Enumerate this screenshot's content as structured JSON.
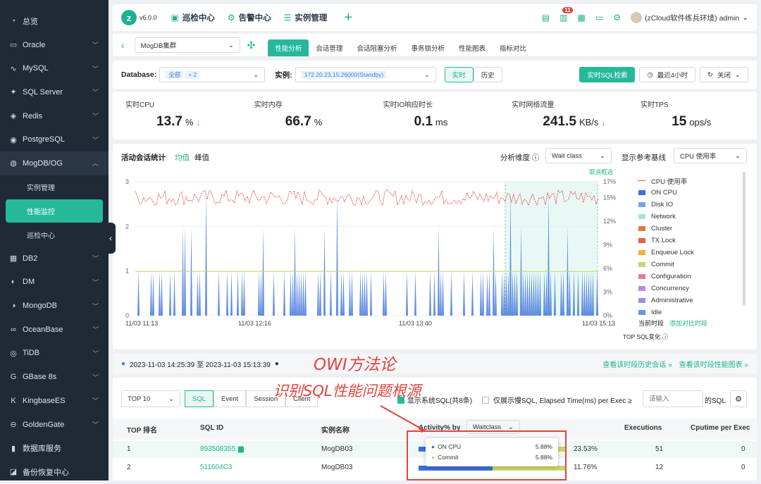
{
  "sidebar": {
    "items": [
      {
        "icon": "gauge-icon",
        "label": "总览"
      },
      {
        "icon": "oracle-icon",
        "label": "Oracle"
      },
      {
        "icon": "mysql-icon",
        "label": "MySQL"
      },
      {
        "icon": "sqlserver-icon",
        "label": "SQL Server"
      },
      {
        "icon": "redis-icon",
        "label": "Redis"
      },
      {
        "icon": "postgresql-icon",
        "label": "PostgreSQL"
      },
      {
        "icon": "mogdb-icon",
        "label": "MogDB/OG"
      },
      {
        "icon": "db2-icon",
        "label": "DB2"
      },
      {
        "icon": "dm-icon",
        "label": "DM"
      },
      {
        "icon": "mongodb-icon",
        "label": "MongoDB"
      },
      {
        "icon": "oceanbase-icon",
        "label": "OceanBase"
      },
      {
        "icon": "tidb-icon",
        "label": "TiDB"
      },
      {
        "icon": "gbase-icon",
        "label": "GBase 8s"
      },
      {
        "icon": "kingbase-icon",
        "label": "KingbaseES"
      },
      {
        "icon": "goldengate-icon",
        "label": "GoldenGate"
      },
      {
        "icon": "database-service-icon",
        "label": "数据库服务"
      },
      {
        "icon": "backup-icon",
        "label": "备份恢复中心"
      }
    ],
    "sub": [
      "实例管理",
      "性能监控",
      "巡检中心"
    ]
  },
  "top": {
    "version": "v6.0.0",
    "nav": [
      "巡检中心",
      "告警中心",
      "实例管理"
    ],
    "badge": "11",
    "user": "(zCloud软件练兵环境) admin"
  },
  "tabs": {
    "cluster": "MogDB集群",
    "items": [
      "性能分析",
      "会话管理",
      "会话阻塞分析",
      "事务锁分析",
      "性能图表",
      "指标对比"
    ]
  },
  "filter": {
    "db_label": "Database:",
    "db_tag": "全部",
    "db_more": "+ 2",
    "inst_label": "实例:",
    "inst_value": "172.20.23.15:26000(Standby)",
    "realtime": "实时",
    "history": "历史",
    "sql_search": "实时SQL检索",
    "time": "最近4小时",
    "refresh": "关闭"
  },
  "metrics": [
    {
      "label": "实时CPU",
      "value": "13.7",
      "unit": "%",
      "arrow": "↓"
    },
    {
      "label": "实时内存",
      "value": "66.7",
      "unit": "%",
      "arrow": ""
    },
    {
      "label": "实时IO响应时长",
      "value": "0.1",
      "unit": "ms",
      "arrow": ""
    },
    {
      "label": "实时网络流量",
      "value": "241.5",
      "unit": "KB/s",
      "arrow": "↓"
    },
    {
      "label": "实时TPS",
      "value": "15",
      "unit": "ops/s",
      "arrow": ""
    }
  ],
  "chart_header": {
    "title": "活动会话统计",
    "avg": "均值",
    "peak": "峰值",
    "dim_label": "分析维度",
    "dim_value": "Wait class",
    "base_label": "显示参考基线",
    "base_value": "CPU 使用率",
    "cancel": "取消框选",
    "current": "当前时段",
    "add_compare": "添加对比时段",
    "top_sql": "TOP SQL变化"
  },
  "chart_data": {
    "type": "area",
    "yticks_left": [
      "0",
      "1",
      "2",
      "3"
    ],
    "yticks_right": [
      "0%",
      "3%",
      "6%",
      "9%",
      "12%",
      "15%",
      "17%"
    ],
    "xticks": [
      "11/03 11:13",
      "11/03 12:16",
      "11/03 13:40",
      "11/03 15:13"
    ],
    "ylim_left": [
      0,
      3
    ],
    "ylim_right": [
      0,
      17
    ],
    "series": [
      {
        "name": "CPU 使用率",
        "color": "#e7423c"
      },
      {
        "name": "ON CPU",
        "color": "#3a6fdc"
      },
      {
        "name": "Disk IO",
        "color": "#6fa8e8"
      },
      {
        "name": "Network",
        "color": "#a8e3d6"
      },
      {
        "name": "Cluster",
        "color": "#e8744a"
      },
      {
        "name": "TX Lock",
        "color": "#e5603e"
      },
      {
        "name": "Enqueue Lock",
        "color": "#f0b13a"
      },
      {
        "name": "Commit",
        "color": "#c9d66a"
      },
      {
        "name": "Configuration",
        "color": "#e77a9f"
      },
      {
        "name": "Concurrency",
        "color": "#b98ae6"
      },
      {
        "name": "Administrative",
        "color": "#9c8fe0"
      },
      {
        "name": "Idle",
        "color": "#6c8ff0"
      }
    ],
    "cpu_line_percent": 15,
    "grid": true,
    "legend": "right"
  },
  "info": {
    "range": "2023-11-03 14:25:39 至 2023-11-03 15:13:39",
    "link1": "查看该时段历史会话 »",
    "link2": "查看该时段性能图表 »"
  },
  "annotations": {
    "owi": "OWI方法论",
    "root": "识别SQL性能问题根源"
  },
  "table": {
    "top": "TOP 10",
    "tabs": [
      "SQL",
      "Event",
      "Session",
      "Client"
    ],
    "show_sys": "显示系统SQL(共8条)",
    "only_slow": "仅展示慢SQL, Elapsed Time(ms) per Exec ≥",
    "input_placeholder": "请输入",
    "suffix": "的SQL",
    "headers": [
      "TOP 排名",
      "SQL ID",
      "实例名称",
      "Activity% by",
      "Waitclass",
      "Executions",
      "Cputime per Exec"
    ],
    "rows": [
      {
        "rank": "1",
        "sql_id": "893508355",
        "inst": "MogDB03",
        "pct": "23.53%",
        "exec": "51",
        "cpu": "0"
      },
      {
        "rank": "2",
        "sql_id": "511604C3",
        "inst": "MogDB03",
        "pct": "11.76%",
        "exec": "12",
        "cpu": "0"
      }
    ],
    "tooltip": [
      {
        "name": "ON CPU",
        "value": "5.88%",
        "color": "#3a6fdc"
      },
      {
        "name": "Commit",
        "value": "5.88%",
        "color": "#c9d66a"
      }
    ]
  }
}
